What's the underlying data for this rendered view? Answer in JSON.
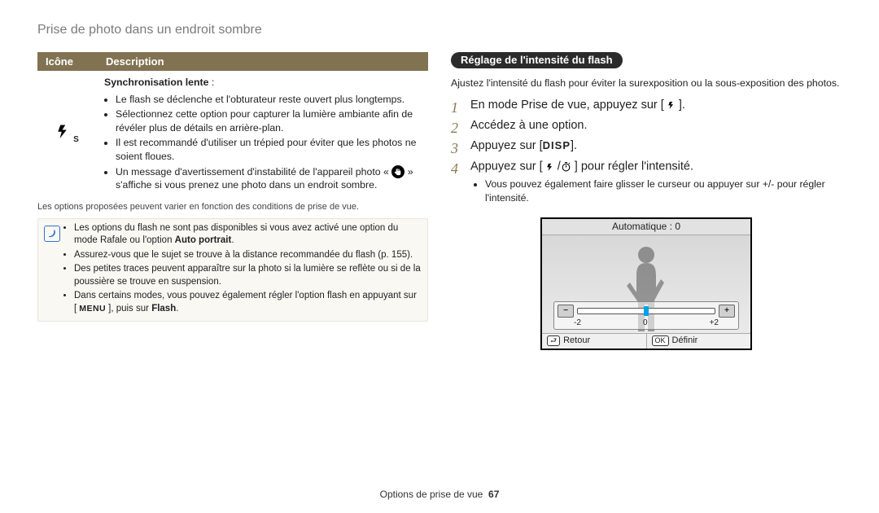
{
  "page_title": "Prise de photo dans un endroit sombre",
  "left": {
    "th_icon": "Icône",
    "th_desc": "Description",
    "row_title": "Synchronisation lente",
    "row_title_suffix": " :",
    "icon_sub": "S",
    "bullets": [
      "Le flash se déclenche et l'obturateur reste ouvert plus longtemps.",
      "Sélectionnez cette option pour capturer la lumière ambiante afin de révéler plus de détails en arrière-plan.",
      "Il est recommandé d'utiliser un trépied pour éviter que les photos ne soient floues.",
      "Un message d'avertissement d'instabilité de l'appareil photo «  » s'affiche si vous prenez une photo dans un endroit sombre."
    ],
    "foot": "Les options proposées peuvent varier en fonction des conditions de prise de vue.",
    "note": [
      "Les options du flash ne sont pas disponibles si vous avez activé une option du mode Rafale ou l'option Auto portrait.",
      "Assurez-vous que le sujet se trouve à la distance recommandée du flash (p. 155).",
      "Des petites traces peuvent apparaître sur la photo si la lumière se reflète ou si de la poussière se trouve en suspension.",
      "Dans certains modes, vous pouvez également régler l'option flash en appuyant sur [MENU], puis sur Flash."
    ],
    "note_auto_portrait": "Auto portrait",
    "note_menu": "MENU",
    "note_flash": "Flash"
  },
  "right": {
    "pill": "Réglage de l'intensité du flash",
    "intro": "Ajustez l'intensité du flash pour éviter la surexposition ou la sous-exposition des photos.",
    "steps": [
      "En mode Prise de vue, appuyez sur [ ].",
      "Accédez à une option.",
      "Appuyez sur [DISP].",
      "Appuyez sur [ / ] pour régler l'intensité."
    ],
    "disp_label": "DISP",
    "step4_sub": "Vous pouvez également faire glisser le curseur ou appuyer sur +/- pour régler l'intensité."
  },
  "lcd": {
    "top": "Automatique : 0",
    "minus": "−",
    "plus": "+",
    "tick_l": "-2",
    "tick_m": "0",
    "tick_r": "+2",
    "back_key": "⮐",
    "back_text": "Retour",
    "ok_key": "OK",
    "ok_text": "Définir"
  },
  "footer": {
    "section": "Options de prise de vue",
    "page": "67"
  }
}
